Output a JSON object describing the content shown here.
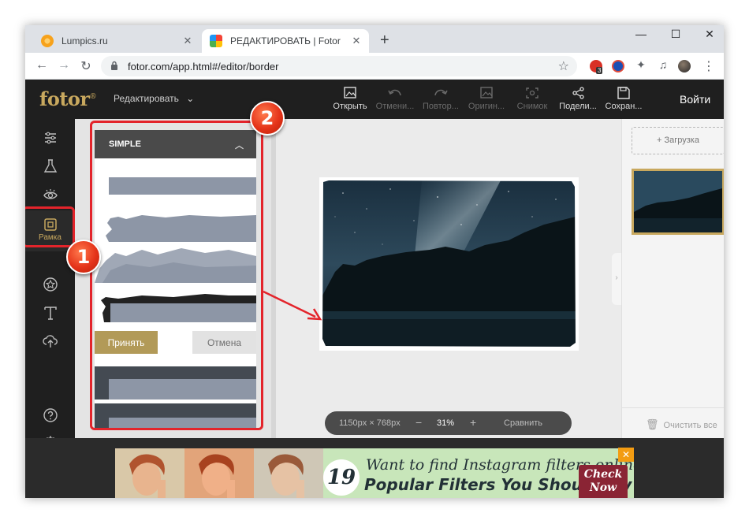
{
  "browser": {
    "tabs": [
      {
        "label": "Lumpics.ru",
        "active": false
      },
      {
        "label": "РЕДАКТИРОВАТЬ | Fotor",
        "active": true
      }
    ],
    "url": "fotor.com/app.html#/editor/border",
    "extension_badge": "3"
  },
  "header": {
    "logo": "fotor",
    "logo_mark": "®",
    "mode": "Редактировать",
    "tools": [
      {
        "label": "Открыть",
        "icon": "image-open-icon",
        "enabled": true
      },
      {
        "label": "Отмени...",
        "icon": "undo-icon",
        "enabled": false
      },
      {
        "label": "Повтор...",
        "icon": "redo-icon",
        "enabled": false
      },
      {
        "label": "Оригин...",
        "icon": "original-icon",
        "enabled": false
      },
      {
        "label": "Снимок",
        "icon": "snapshot-icon",
        "enabled": false
      },
      {
        "label": "Подели...",
        "icon": "share-icon",
        "enabled": true
      },
      {
        "label": "Сохран...",
        "icon": "save-icon",
        "enabled": true
      }
    ],
    "login": "Войти"
  },
  "sidebar": {
    "active_label": "Рамка"
  },
  "border_panel": {
    "section_title": "SIMPLE",
    "accept": "Принять",
    "cancel": "Отмена"
  },
  "zoom": {
    "dimensions": "1150px × 768px",
    "minus": "−",
    "level": "31%",
    "plus": "+",
    "compare": "Сравнить"
  },
  "right_panel": {
    "upload": "Загрузка",
    "upload_plus": "+",
    "clear_all": "Очистить все"
  },
  "ad": {
    "number": "19",
    "line1": "Want to find Instagram filters online?",
    "line2": "Popular Filters You Should Try",
    "cta": "Check Now",
    "close": "✕"
  },
  "annotations": {
    "step1": "1",
    "step2": "2"
  },
  "colors": {
    "accent_gold": "#c8a85e",
    "annotation_red": "#e3242b",
    "app_dark": "#1f1f1f"
  }
}
